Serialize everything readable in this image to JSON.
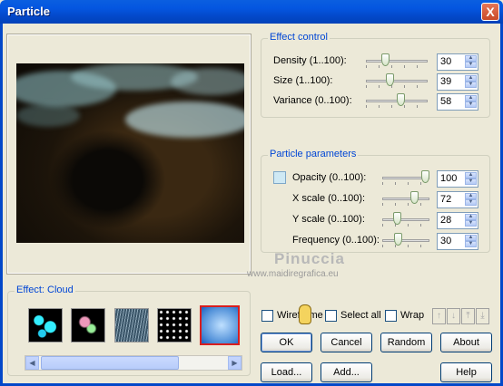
{
  "window": {
    "title": "Particle",
    "close_glyph": "X"
  },
  "effect_control": {
    "legend": "Effect control",
    "rows": [
      {
        "label": "Density (1..100):",
        "value": "30",
        "fraction": 0.29
      },
      {
        "label": "Size (1..100):",
        "value": "39",
        "fraction": 0.38
      },
      {
        "label": "Variance (0..100):",
        "value": "58",
        "fraction": 0.58
      }
    ]
  },
  "particle_parameters": {
    "legend": "Particle parameters",
    "rows": [
      {
        "label": "Opacity (0..100):",
        "value": "100",
        "fraction": 1.0
      },
      {
        "label": "X scale (0..100):",
        "value": "72",
        "fraction": 0.72
      },
      {
        "label": "Y scale (0..100):",
        "value": "28",
        "fraction": 0.28
      },
      {
        "label": "Frequency (0..100):",
        "value": "30",
        "fraction": 0.3
      }
    ]
  },
  "effect_panel": {
    "legend": "Effect: Cloud",
    "thumbnails": [
      "bubbles",
      "bokeh",
      "rain",
      "snow",
      "cloud"
    ],
    "selected_index": 4
  },
  "options": {
    "wireframe": "Wireframe",
    "select_all": "Select all",
    "wrap": "Wrap"
  },
  "buttons": {
    "ok": "OK",
    "cancel": "Cancel",
    "random": "Random",
    "about": "About",
    "load": "Load...",
    "add": "Add...",
    "help": "Help"
  },
  "watermark": {
    "name": "Pinuccia",
    "site": "www.maidiregrafica.eu"
  },
  "colors": {
    "title_bar": "#0348c9",
    "legend": "#0046d5",
    "selected_border": "#d81e1e"
  }
}
